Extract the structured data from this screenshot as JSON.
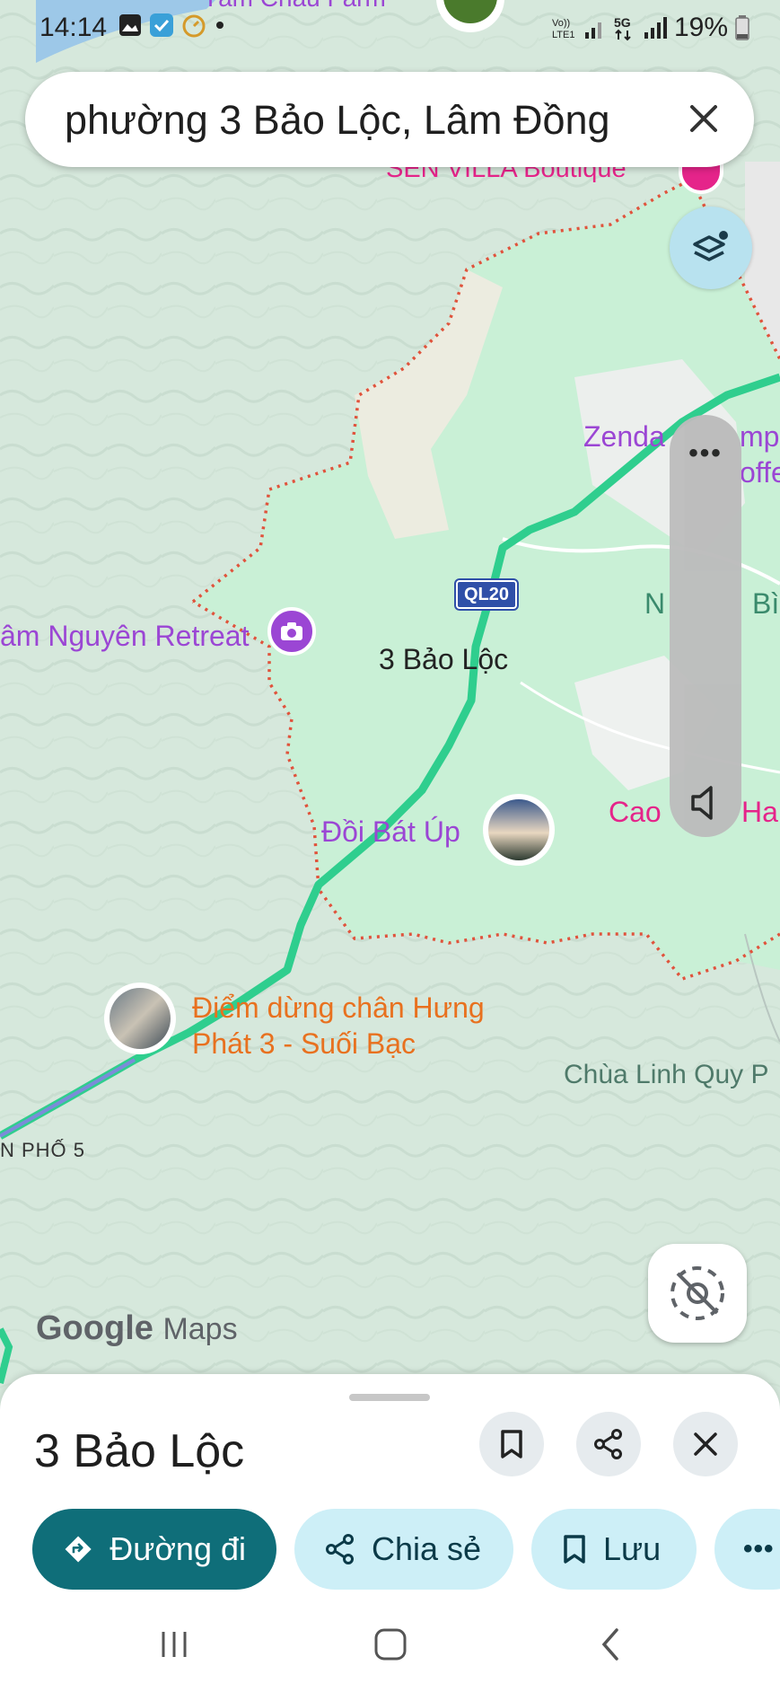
{
  "status_bar": {
    "time": "14:14",
    "battery": "19%",
    "icons": [
      "image-icon",
      "check-app-icon",
      "timer-icon",
      "dot-icon",
      "volte-icon",
      "signal-icon",
      "5g-icon",
      "signal-icon",
      "battery-icon"
    ]
  },
  "search": {
    "query": "phường 3 Bảo Lộc, Lâm Đồng",
    "close_icon": "close-icon"
  },
  "map": {
    "labels": {
      "top_farm": "Tâm Châu Farm",
      "sen_villa": "SEN VILLA Boutique",
      "zenda": "Zenda",
      "zenda_cont1": "mpi",
      "zenda_cont2": "offe",
      "retreat": "âm Nguyên Retreat",
      "ward": "3 Bảo Lộc",
      "highway": "QL20",
      "n_bi_left": "N",
      "n_bi_right": "Bì",
      "doi_bat_up": "Đồi Bát Úp",
      "cao_left": "Cao",
      "cao_right": "Han",
      "stop_line1": "Điểm dừng chân Hưng",
      "stop_line2": "Phát 3 - Suối Bạc",
      "pagoda": "Chùa Linh Quy P",
      "street": "N PHỐ 5",
      "watermark_google": "Google",
      "watermark_maps": "Maps"
    },
    "colors": {
      "land": "#d9e9df",
      "region": "#c8f0d6",
      "route": "#2fce8e",
      "border": "#e0533c",
      "poi_purple": "#9b46d4",
      "poi_orange": "#e8711f",
      "poi_pink": "#e5248a"
    }
  },
  "volume_panel": {
    "more_icon": "more-horizontal-icon",
    "speaker_icon": "speaker-icon"
  },
  "bottom_sheet": {
    "title": "3 Bảo Lộc",
    "actions": {
      "directions": "Đường đi",
      "share": "Chia sẻ",
      "save": "Lưu",
      "more": "more-horizontal-icon"
    }
  }
}
